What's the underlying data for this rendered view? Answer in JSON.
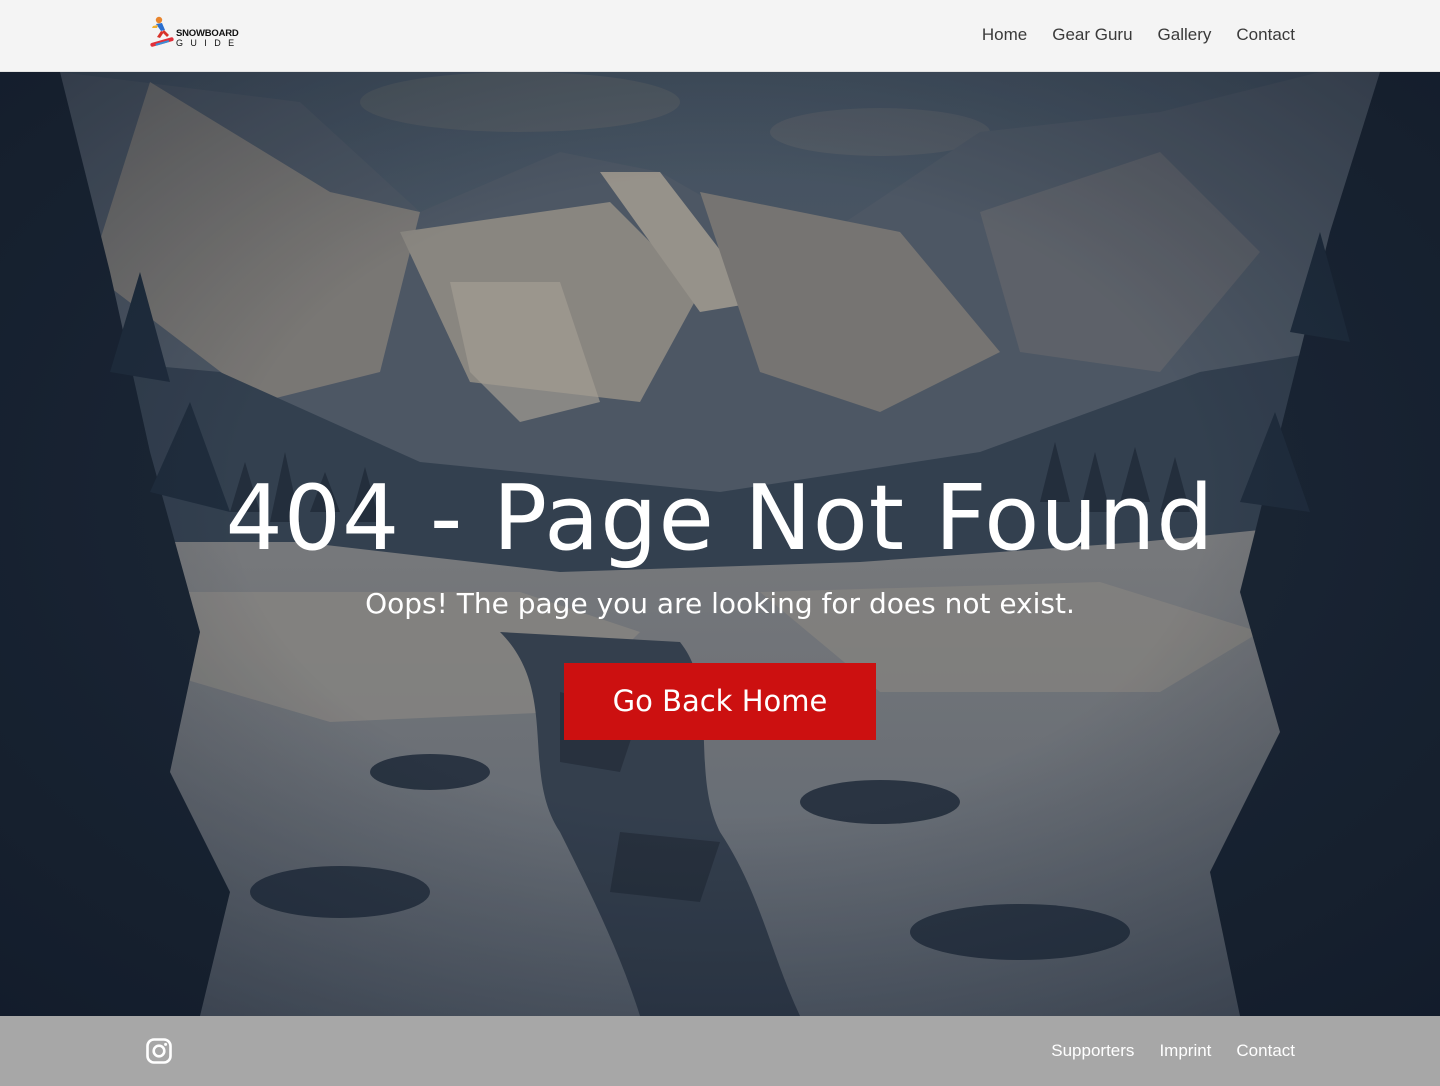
{
  "brand": {
    "logo_top": "SNOWBOARD",
    "logo_bottom": "GUIDE"
  },
  "nav": {
    "items": [
      {
        "label": "Home"
      },
      {
        "label": "Gear Guru"
      },
      {
        "label": "Gallery"
      },
      {
        "label": "Contact"
      }
    ]
  },
  "hero": {
    "title": "404 - Page Not Found",
    "subtitle": "Oops! The page you are looking for does not exist.",
    "cta_label": "Go Back Home"
  },
  "footer": {
    "social_icon": "instagram-icon",
    "links": [
      {
        "label": "Supporters"
      },
      {
        "label": "Imprint"
      },
      {
        "label": "Contact"
      }
    ]
  },
  "colors": {
    "header_bg": "#f4f4f4",
    "button_bg": "#cc1010",
    "footer_bg": "#a7a7a7"
  }
}
